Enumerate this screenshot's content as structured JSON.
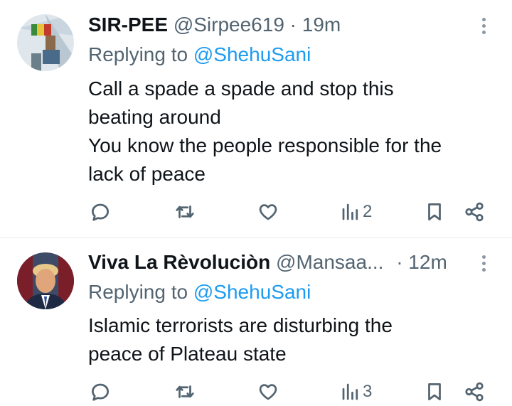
{
  "tweets": [
    {
      "name": "SIR-PEE",
      "handle": "@Sirpee619",
      "separator": "·",
      "time": "19m",
      "replying_prefix": "Replying to",
      "replying_to": "@ShehuSani",
      "lines": [
        "Call a spade a spade and stop this",
        "beating around",
        "You know the people responsible for the",
        "lack of peace"
      ],
      "views": "2"
    },
    {
      "name": "Viva La Rèvoluciòn",
      "handle": "@Mansaa...",
      "separator": "·",
      "time": "12m",
      "replying_prefix": "Replying to",
      "replying_to": "@ShehuSani",
      "lines": [
        "Islamic terrorists are disturbing the",
        "peace of Plateau state"
      ],
      "views": "3"
    }
  ],
  "icons": {
    "reply": "reply-icon",
    "retweet": "retweet-icon",
    "like": "heart-icon",
    "views": "views-icon",
    "bookmark": "bookmark-icon",
    "share": "share-icon",
    "more": "more-vertical-icon"
  },
  "colors": {
    "text": "#0f1419",
    "secondary": "#536471",
    "link": "#1d9bf0",
    "divider": "#e6e9ec"
  }
}
